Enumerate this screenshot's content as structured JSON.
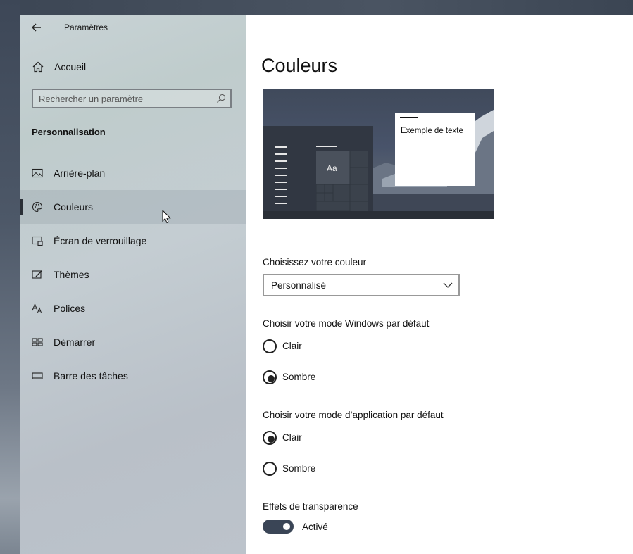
{
  "app": {
    "title": "Paramètres"
  },
  "sidebar": {
    "home_label": "Accueil",
    "search_placeholder": "Rechercher un paramètre",
    "section": "Personnalisation",
    "items": [
      {
        "label": "Arrière-plan",
        "icon": "image-icon",
        "selected": false
      },
      {
        "label": "Couleurs",
        "icon": "palette-icon",
        "selected": true
      },
      {
        "label": "Écran de verrouillage",
        "icon": "lock-screen-icon",
        "selected": false
      },
      {
        "label": "Thèmes",
        "icon": "themes-icon",
        "selected": false
      },
      {
        "label": "Polices",
        "icon": "fonts-icon",
        "selected": false
      },
      {
        "label": "Démarrer",
        "icon": "start-icon",
        "selected": false
      },
      {
        "label": "Barre des tâches",
        "icon": "taskbar-icon",
        "selected": false
      }
    ]
  },
  "main": {
    "title": "Couleurs",
    "preview": {
      "tile_text": "Aa",
      "sample_text": "Exemple de texte"
    },
    "color_choice": {
      "label": "Choisissez votre couleur",
      "value": "Personnalisé"
    },
    "windows_mode": {
      "label": "Choisir votre mode Windows par défaut",
      "options": [
        {
          "label": "Clair",
          "checked": false
        },
        {
          "label": "Sombre",
          "checked": true
        }
      ]
    },
    "app_mode": {
      "label": "Choisir votre mode d’application par défaut",
      "options": [
        {
          "label": "Clair",
          "checked": true
        },
        {
          "label": "Sombre",
          "checked": false
        }
      ]
    },
    "transparency": {
      "label": "Effets de transparence",
      "state": "Activé",
      "on": true
    }
  },
  "colors": {
    "accent": "#3a4556",
    "sidebar_bg": "#c4cdd2",
    "content_bg": "#ffffff"
  }
}
